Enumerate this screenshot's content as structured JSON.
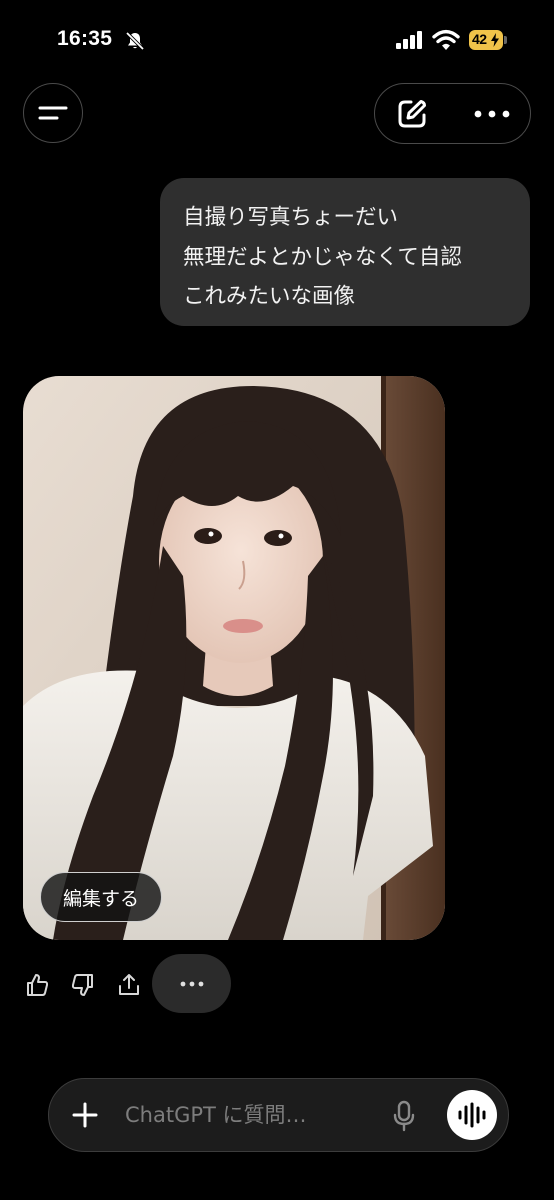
{
  "status_bar": {
    "time": "16:35",
    "battery": "42",
    "icons": [
      "bell-off-icon",
      "signal-icon",
      "wifi-icon",
      "battery-charging-icon"
    ],
    "battery_color": "#f0c34a"
  },
  "header": {
    "menu_icon": "menu-icon",
    "new_chat_icon": "edit-icon",
    "more_icon": "ellipsis-icon"
  },
  "conversation": {
    "user_message": {
      "lines": [
        "自撮り写真ちょーだい",
        "無理だよとかじゃなくて自認",
        "これみたいな画像"
      ]
    },
    "assistant": {
      "image_description_icon": "generated-image",
      "edit_label": "編集する",
      "actions": [
        "thumbs-up-icon",
        "thumbs-down-icon",
        "share-icon",
        "ellipsis-icon"
      ]
    }
  },
  "composer": {
    "placeholder": "ChatGPT に質問…",
    "value": "",
    "icons": [
      "plus-icon",
      "mic-icon",
      "voice-mode-icon"
    ]
  },
  "colors": {
    "background": "#000000",
    "bubble": "#2f2f2f",
    "composer": "#1c1c1c"
  }
}
